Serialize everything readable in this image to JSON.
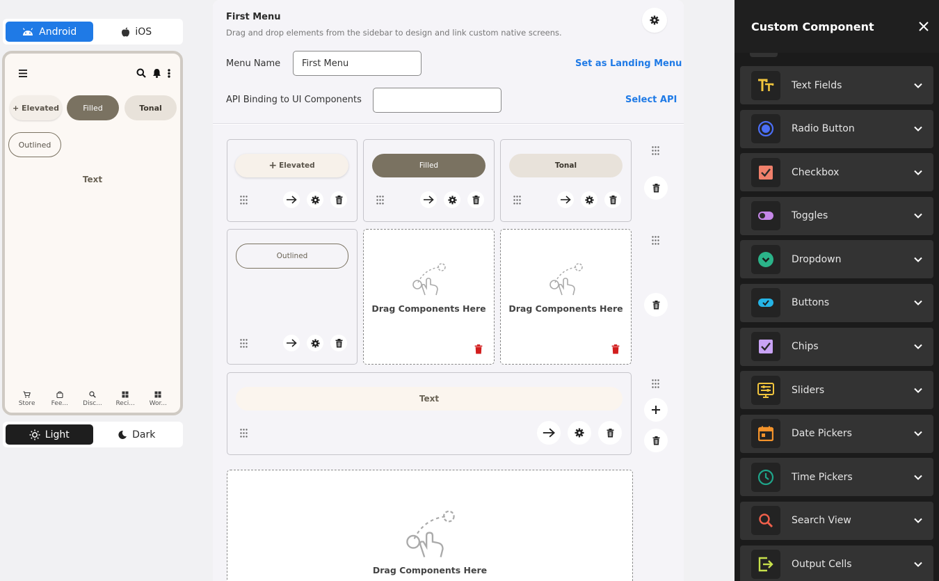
{
  "platform": {
    "android_label": "Android",
    "ios_label": "iOS"
  },
  "preview": {
    "elevated": "+ Elevated",
    "filled": "Filled",
    "tonal": "Tonal",
    "outlined": "Outlined",
    "text": "Text",
    "nav": [
      "Store",
      "Fee...",
      "Disc...",
      "Reci...",
      "Wor..."
    ]
  },
  "theme": {
    "light_label": "Light",
    "dark_label": "Dark"
  },
  "editor": {
    "title": "First Menu",
    "subtitle": "Drag and drop elements from the sidebar to design and link custom native screens.",
    "menu_name_label": "Menu Name",
    "menu_name_value": "First Menu",
    "landing_link": "Set as Landing Menu",
    "api_label": "API Binding to UI Components",
    "api_value": "",
    "select_api": "Select API",
    "cells": {
      "elevated": "Elevated",
      "filled": "Filled",
      "tonal": "Tonal",
      "outlined": "Outlined",
      "text": "Text",
      "drop_1": "Drag Components Here",
      "drop_2": "Drag Components Here",
      "drop_3": "Drag Components Here"
    }
  },
  "panel": {
    "title": "Custom Component",
    "items": [
      {
        "label": "Text Fields",
        "icon": "text-fields-icon",
        "color": "#f2c53d"
      },
      {
        "label": "Radio Button",
        "icon": "radio-button-icon",
        "color": "#4b6ef5"
      },
      {
        "label": "Checkbox",
        "icon": "checkbox-icon",
        "color": "#f0806b"
      },
      {
        "label": "Toggles",
        "icon": "toggle-icon",
        "color": "#c587e8"
      },
      {
        "label": "Dropdown",
        "icon": "dropdown-icon",
        "color": "#2bb389"
      },
      {
        "label": "Buttons",
        "icon": "buttons-icon",
        "color": "#25b4e6"
      },
      {
        "label": "Chips",
        "icon": "chips-icon",
        "color": "#c9a3f5"
      },
      {
        "label": "Sliders",
        "icon": "sliders-icon",
        "color": "#f2c53d"
      },
      {
        "label": "Date Pickers",
        "icon": "date-picker-icon",
        "color": "#f2922b"
      },
      {
        "label": "Time Pickers",
        "icon": "time-picker-icon",
        "color": "#1fa58a"
      },
      {
        "label": "Search View",
        "icon": "search-view-icon",
        "color": "#f0604b"
      },
      {
        "label": "Output Cells",
        "icon": "output-cells-icon",
        "color": "#c6e04b"
      }
    ]
  }
}
